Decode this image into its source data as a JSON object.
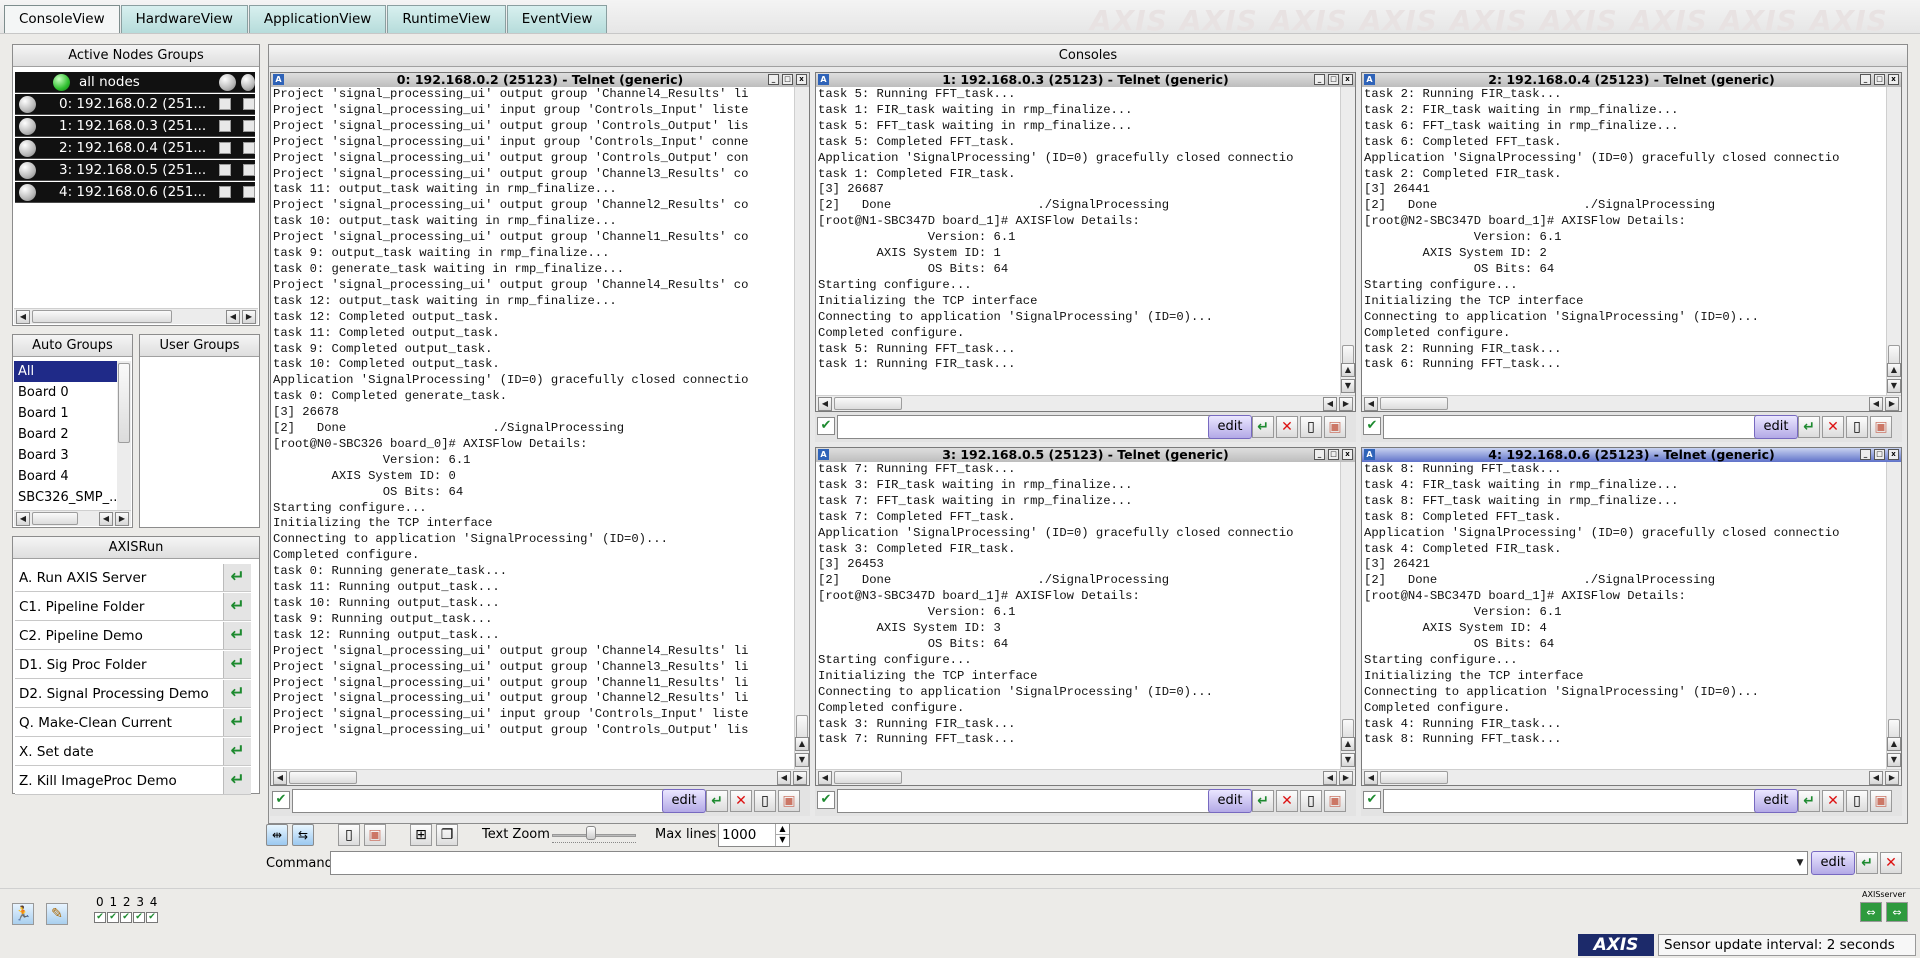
{
  "tabs": [
    "ConsoleView",
    "HardwareView",
    "ApplicationView",
    "RuntimeView",
    "EventView"
  ],
  "watermark": "AXIS",
  "nodes": {
    "title": "Active Nodes Groups",
    "all": "all nodes",
    "items": [
      "0: 192.168.0.2 (251...",
      "1: 192.168.0.3 (251...",
      "2: 192.168.0.4 (251...",
      "3: 192.168.0.5 (251...",
      "4: 192.168.0.6 (251..."
    ]
  },
  "auto_groups": {
    "title": "Auto Groups",
    "items": [
      "All",
      "Board 0",
      "Board 1",
      "Board 2",
      "Board 3",
      "Board 4",
      "SBC326_SMP_..."
    ]
  },
  "user_groups": {
    "title": "User Groups"
  },
  "axisrun": {
    "title": "AXISRun",
    "items": [
      "A. Run AXIS Server",
      "C1. Pipeline Folder",
      "C2. Pipeline Demo",
      "D1. Sig Proc Folder",
      "D2. Signal Processing Demo",
      "Q. Make-Clean Current",
      "X. Set date",
      "Z. Kill ImageProc Demo"
    ]
  },
  "consoles": {
    "title": "Consoles",
    "edit": "edit",
    "windows": [
      {
        "title": "0: 192.168.0.2 (25123) - Telnet (generic)",
        "lines": [
          "Project 'signal_processing_ui' output group 'Channel4_Results' li",
          "Project 'signal_processing_ui' input group 'Controls_Input' liste",
          "Project 'signal_processing_ui' output group 'Controls_Output' lis",
          "Project 'signal_processing_ui' input group 'Controls_Input' conne",
          "Project 'signal_processing_ui' output group 'Controls_Output' con",
          "Project 'signal_processing_ui' output group 'Channel3_Results' co",
          "task 11: output_task waiting in rmp_finalize...",
          "Project 'signal_processing_ui' output group 'Channel2_Results' co",
          "task 10: output_task waiting in rmp_finalize...",
          "Project 'signal_processing_ui' output group 'Channel1_Results' co",
          "task 9: output_task waiting in rmp_finalize...",
          "task 0: generate_task waiting in rmp_finalize...",
          "Project 'signal_processing_ui' output group 'Channel4_Results' co",
          "task 12: output_task waiting in rmp_finalize...",
          "task 12: Completed output_task.",
          "task 11: Completed output_task.",
          "task 9: Completed output_task.",
          "task 10: Completed output_task.",
          "Application 'SignalProcessing' (ID=0) gracefully closed connectio",
          "task 0: Completed generate_task.",
          "[3] 26678",
          "[2]   Done                    ./SignalProcessing",
          "[root@N0-SBC326 board_0]# AXISFlow Details:",
          "               Version: 6.1",
          "        AXIS System ID: 0",
          "               OS Bits: 64",
          "Starting configure...",
          "Initializing the TCP interface",
          "Connecting to application 'SignalProcessing' (ID=0)...",
          "Completed configure.",
          "task 0: Running generate_task...",
          "task 11: Running output_task...",
          "task 10: Running output_task...",
          "task 9: Running output_task...",
          "task 12: Running output_task...",
          "Project 'signal_processing_ui' output group 'Channel4_Results' li",
          "Project 'signal_processing_ui' output group 'Channel3_Results' li",
          "Project 'signal_processing_ui' output group 'Channel1_Results' li",
          "Project 'signal_processing_ui' output group 'Channel2_Results' li",
          "Project 'signal_processing_ui' input group 'Controls_Input' liste",
          "Project 'signal_processing_ui' output group 'Controls_Output' lis"
        ]
      },
      {
        "title": "1: 192.168.0.3 (25123) - Telnet (generic)",
        "lines": [
          "task 5: Running FFT_task...",
          "task 1: FIR_task waiting in rmp_finalize...",
          "task 5: FFT_task waiting in rmp_finalize...",
          "task 5: Completed FFT_task.",
          "Application 'SignalProcessing' (ID=0) gracefully closed connectio",
          "task 1: Completed FIR_task.",
          "[3] 26687",
          "[2]   Done                    ./SignalProcessing",
          "[root@N1-SBC347D board_1]# AXISFlow Details:",
          "               Version: 6.1",
          "        AXIS System ID: 1",
          "               OS Bits: 64",
          "Starting configure...",
          "Initializing the TCP interface",
          "Connecting to application 'SignalProcessing' (ID=0)...",
          "Completed configure.",
          "task 5: Running FFT_task...",
          "task 1: Running FIR_task..."
        ]
      },
      {
        "title": "2: 192.168.0.4 (25123) - Telnet (generic)",
        "lines": [
          "task 2: Running FIR_task...",
          "task 2: FIR_task waiting in rmp_finalize...",
          "task 6: FFT_task waiting in rmp_finalize...",
          "task 6: Completed FFT_task.",
          "Application 'SignalProcessing' (ID=0) gracefully closed connectio",
          "task 2: Completed FIR_task.",
          "[3] 26441",
          "[2]   Done                    ./SignalProcessing",
          "[root@N2-SBC347D board_1]# AXISFlow Details:",
          "               Version: 6.1",
          "        AXIS System ID: 2",
          "               OS Bits: 64",
          "Starting configure...",
          "Initializing the TCP interface",
          "Connecting to application 'SignalProcessing' (ID=0)...",
          "Completed configure.",
          "task 2: Running FIR_task...",
          "task 6: Running FFT_task..."
        ]
      },
      {
        "title": "3: 192.168.0.5 (25123) - Telnet (generic)",
        "lines": [
          "task 7: Running FFT_task...",
          "task 3: FIR_task waiting in rmp_finalize...",
          "task 7: FFT_task waiting in rmp_finalize...",
          "task 7: Completed FFT_task.",
          "Application 'SignalProcessing' (ID=0) gracefully closed connectio",
          "task 3: Completed FIR_task.",
          "[3] 26453",
          "[2]   Done                    ./SignalProcessing",
          "[root@N3-SBC347D board_1]# AXISFlow Details:",
          "               Version: 6.1",
          "        AXIS System ID: 3",
          "               OS Bits: 64",
          "Starting configure...",
          "Initializing the TCP interface",
          "Connecting to application 'SignalProcessing' (ID=0)...",
          "Completed configure.",
          "task 3: Running FIR_task...",
          "task 7: Running FFT_task..."
        ]
      },
      {
        "title": "4: 192.168.0.6 (25123) - Telnet (generic)",
        "lines": [
          "task 8: Running FFT_task...",
          "task 4: FIR_task waiting in rmp_finalize...",
          "task 8: FFT_task waiting in rmp_finalize...",
          "task 8: Completed FFT_task.",
          "Application 'SignalProcessing' (ID=0) gracefully closed connectio",
          "task 4: Completed FIR_task.",
          "[3] 26421",
          "[2]   Done                    ./SignalProcessing",
          "[root@N4-SBC347D board_1]# AXISFlow Details:",
          "               Version: 6.1",
          "        AXIS System ID: 4",
          "               OS Bits: 64",
          "Starting configure...",
          "Initializing the TCP interface",
          "Connecting to application 'SignalProcessing' (ID=0)...",
          "Completed configure.",
          "task 4: Running FIR_task...",
          "task 8: Running FFT_task..."
        ]
      }
    ]
  },
  "toolbar": {
    "text_zoom": "Text Zoom",
    "max_lines_label": "Max lines",
    "max_lines": "1000",
    "command_label": "Command",
    "edit": "edit"
  },
  "bottom": {
    "board_nums": "0 1 2 3 4",
    "server_label": "AXISserver",
    "logo": "AXIS",
    "status": "Sensor update interval: 2 seconds"
  },
  "colors": {
    "tab": "#b6dcdb",
    "node_bg": "#111111",
    "active_title": "#5f72c9",
    "edit_button": "#b3a9e6"
  }
}
